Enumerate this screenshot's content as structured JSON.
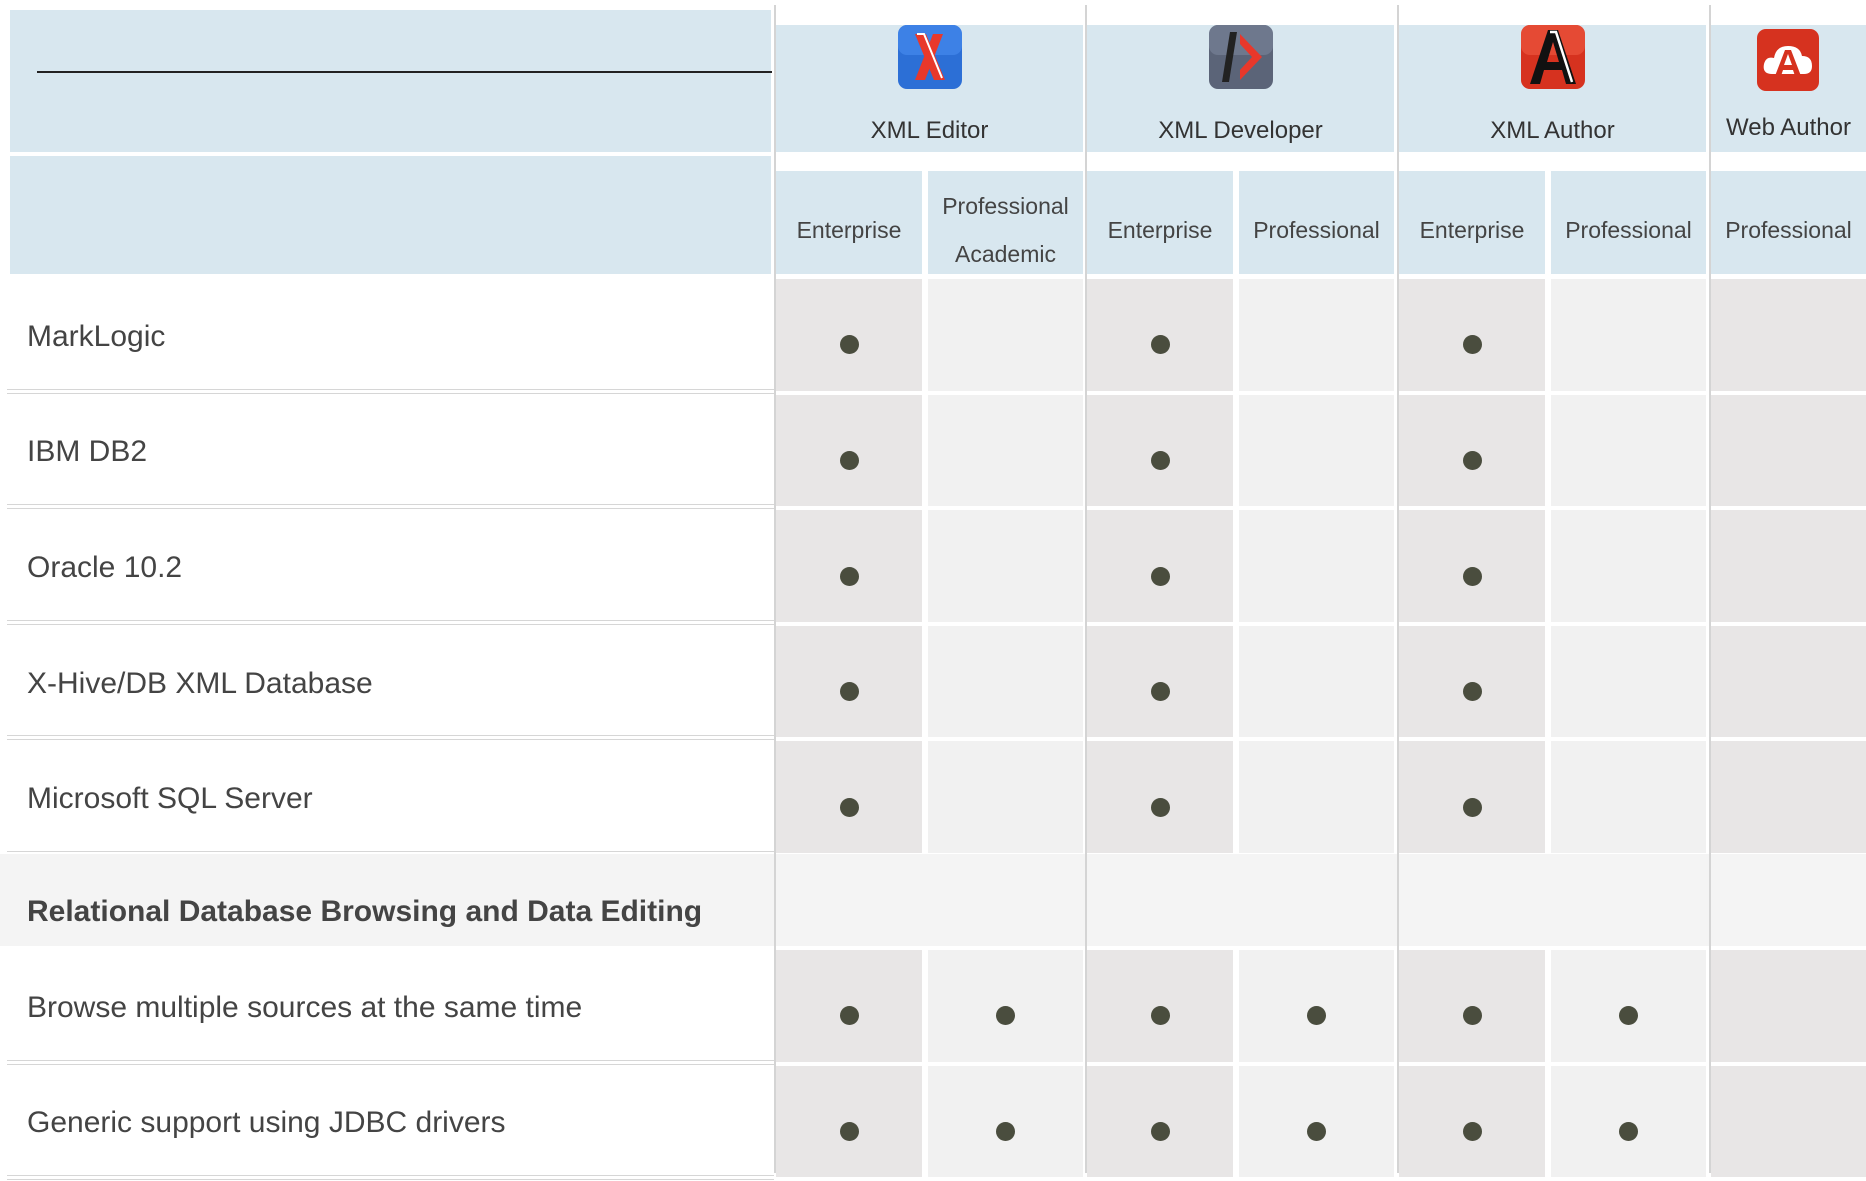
{
  "products": [
    {
      "name": "XML Editor",
      "icon": "xml-editor-icon",
      "color": "#2a6fd8",
      "glyph": "X"
    },
    {
      "name": "XML Developer",
      "icon": "xml-developer-icon",
      "color": "#5a6275",
      "glyph": "/>"
    },
    {
      "name": "XML Author",
      "icon": "xml-author-icon",
      "color": "#d8331f",
      "glyph": "A"
    },
    {
      "name": "Web Author",
      "icon": "web-author-icon",
      "color": "#d8331f",
      "glyph": "A"
    }
  ],
  "editions": [
    "Enterprise",
    "Professional Academic",
    "Enterprise",
    "Professional",
    "Enterprise",
    "Professional",
    "Professional"
  ],
  "rows": [
    {
      "label": "MarkLogic",
      "support": [
        true,
        false,
        true,
        false,
        true,
        false,
        false
      ]
    },
    {
      "label": "IBM DB2",
      "support": [
        true,
        false,
        true,
        false,
        true,
        false,
        false
      ]
    },
    {
      "label": "Oracle 10.2",
      "support": [
        true,
        false,
        true,
        false,
        true,
        false,
        false
      ]
    },
    {
      "label": "X-Hive/DB XML Database",
      "support": [
        true,
        false,
        true,
        false,
        true,
        false,
        false
      ]
    },
    {
      "label": "Microsoft SQL Server",
      "support": [
        true,
        false,
        true,
        false,
        true,
        false,
        false
      ]
    }
  ],
  "section": {
    "title": "Relational Database Browsing and Data Editing"
  },
  "rows2": [
    {
      "label": "Browse multiple sources at the same time",
      "support": [
        true,
        true,
        true,
        true,
        true,
        true,
        false
      ]
    },
    {
      "label": "Generic support using JDBC drivers",
      "support": [
        true,
        true,
        true,
        true,
        true,
        true,
        false
      ]
    }
  ]
}
